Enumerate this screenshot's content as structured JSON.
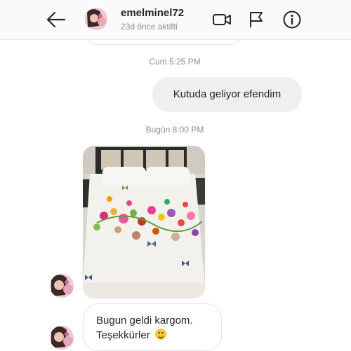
{
  "header": {
    "username": "emelminel72",
    "status": "23d önce aktifti",
    "icons": [
      "back-arrow-icon",
      "video-call-icon",
      "flag-icon",
      "info-icon"
    ]
  },
  "messages": {
    "timestamp_1": "Cum 5:25 PM",
    "outgoing_text": "Kutuda geliyor efendim",
    "timestamp_2": "Bugün 8:00 PM",
    "photo": "photo of a bed with a white floral duvet cover",
    "incoming_line1": "Bugun geldi kargom.",
    "incoming_line2": "Teşekkürler"
  },
  "colors": {
    "header_bg": "#fafafa",
    "outgoing_bubble": "#efefef",
    "incoming_border": "#e3e3e3",
    "meta_text": "#8e8e8e"
  }
}
